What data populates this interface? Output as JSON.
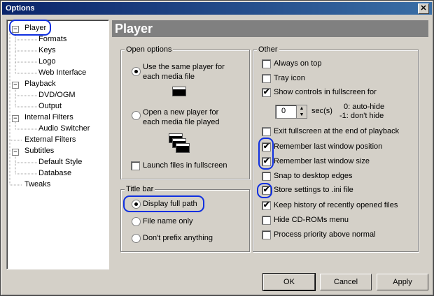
{
  "window": {
    "title": "Options",
    "close_glyph": "✕"
  },
  "tree": {
    "expander_open": "−",
    "items": [
      {
        "label": "Player"
      },
      {
        "label": "Formats"
      },
      {
        "label": "Keys"
      },
      {
        "label": "Logo"
      },
      {
        "label": "Web Interface"
      },
      {
        "label": "Playback"
      },
      {
        "label": "DVD/OGM"
      },
      {
        "label": "Output"
      },
      {
        "label": "Internal Filters"
      },
      {
        "label": "Audio Switcher"
      },
      {
        "label": "External Filters"
      },
      {
        "label": "Subtitles"
      },
      {
        "label": "Default Style"
      },
      {
        "label": "Database"
      },
      {
        "label": "Tweaks"
      }
    ]
  },
  "page_title": "Player",
  "open_options": {
    "label": "Open options",
    "same_player": "Use the same player for each media file",
    "new_player": "Open a new player for each media file played",
    "launch_fullscreen": "Launch files in fullscreen",
    "selected": "same_player"
  },
  "title_bar": {
    "label": "Title bar",
    "full_path": "Display full path",
    "file_name": "File name only",
    "no_prefix": "Don't prefix anything",
    "selected": "full_path"
  },
  "other": {
    "label": "Other",
    "always_on_top": {
      "label": "Always on top",
      "checked": false
    },
    "tray_icon": {
      "label": "Tray icon",
      "checked": false
    },
    "show_controls": {
      "label": "Show controls in fullscreen for",
      "checked": true
    },
    "seconds": {
      "value": "0",
      "unit": "sec(s)",
      "hint1": "0: auto-hide",
      "hint2": "-1: don't hide"
    },
    "exit_fullscreen": {
      "label": "Exit fullscreen at the end of playback",
      "checked": false
    },
    "remember_pos": {
      "label": "Remember last window position",
      "checked": true
    },
    "remember_size": {
      "label": "Remember last window size",
      "checked": true
    },
    "snap": {
      "label": "Snap to desktop edges",
      "checked": false
    },
    "store_ini": {
      "label": "Store settings to .ini file",
      "checked": true
    },
    "keep_history": {
      "label": "Keep history of recently opened files",
      "checked": true
    },
    "hide_cdroms": {
      "label": "Hide CD-ROMs menu",
      "checked": false
    },
    "priority": {
      "label": "Process priority above normal",
      "checked": false
    }
  },
  "check_glyph": "✔",
  "buttons": {
    "ok": "OK",
    "cancel": "Cancel",
    "apply": "Apply"
  },
  "colors": {
    "highlight": "#1030e0",
    "titlebar": "#0a246a",
    "header": "#808080"
  }
}
